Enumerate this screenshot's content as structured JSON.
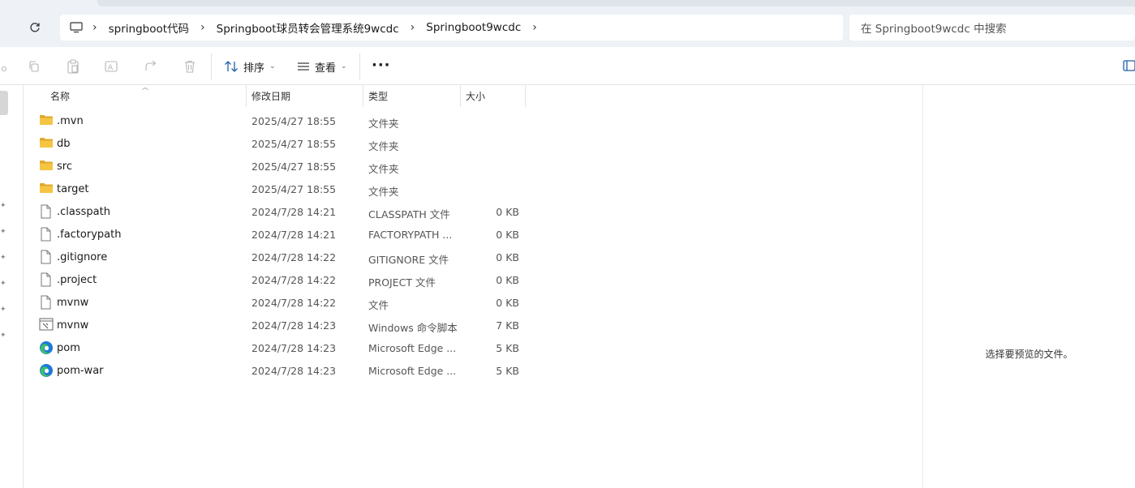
{
  "breadcrumb": {
    "items": [
      "springboot代码",
      "Springboot球员转会管理系统9wcdc",
      "Springboot9wcdc"
    ]
  },
  "search": {
    "placeholder": "在 Springboot9wcdc 中搜索"
  },
  "toolbar": {
    "sort_label": "排序",
    "view_label": "查看",
    "more_label": "···"
  },
  "columns": {
    "name": "名称",
    "date": "修改日期",
    "type": "类型",
    "size": "大小"
  },
  "files": [
    {
      "name": ".mvn",
      "date": "2025/4/27 18:55",
      "type": "文件夹",
      "size": "",
      "icon": "folder-icon"
    },
    {
      "name": "db",
      "date": "2025/4/27 18:55",
      "type": "文件夹",
      "size": "",
      "icon": "folder-icon"
    },
    {
      "name": "src",
      "date": "2025/4/27 18:55",
      "type": "文件夹",
      "size": "",
      "icon": "folder-icon"
    },
    {
      "name": "target",
      "date": "2025/4/27 18:55",
      "type": "文件夹",
      "size": "",
      "icon": "folder-icon"
    },
    {
      "name": ".classpath",
      "date": "2024/7/28 14:21",
      "type": "CLASSPATH 文件",
      "size": "0 KB",
      "icon": "file-icon"
    },
    {
      "name": ".factorypath",
      "date": "2024/7/28 14:21",
      "type": "FACTORYPATH ...",
      "size": "0 KB",
      "icon": "file-icon"
    },
    {
      "name": ".gitignore",
      "date": "2024/7/28 14:22",
      "type": "GITIGNORE 文件",
      "size": "0 KB",
      "icon": "file-icon"
    },
    {
      "name": ".project",
      "date": "2024/7/28 14:22",
      "type": "PROJECT 文件",
      "size": "0 KB",
      "icon": "file-icon"
    },
    {
      "name": "mvnw",
      "date": "2024/7/28 14:22",
      "type": "文件",
      "size": "0 KB",
      "icon": "file-icon"
    },
    {
      "name": "mvnw",
      "date": "2024/7/28 14:23",
      "type": "Windows 命令脚本",
      "size": "7 KB",
      "icon": "script-icon"
    },
    {
      "name": "pom",
      "date": "2024/7/28 14:23",
      "type": "Microsoft Edge ...",
      "size": "5 KB",
      "icon": "edge-icon"
    },
    {
      "name": "pom-war",
      "date": "2024/7/28 14:23",
      "type": "Microsoft Edge ...",
      "size": "5 KB",
      "icon": "edge-icon"
    }
  ],
  "preview": {
    "message": "选择要预览的文件。"
  },
  "colors": {
    "folder": "#f5c542",
    "folder_dark": "#e0a82e",
    "edge_blue": "#1d7ad9",
    "edge_green": "#3ebf6c"
  }
}
